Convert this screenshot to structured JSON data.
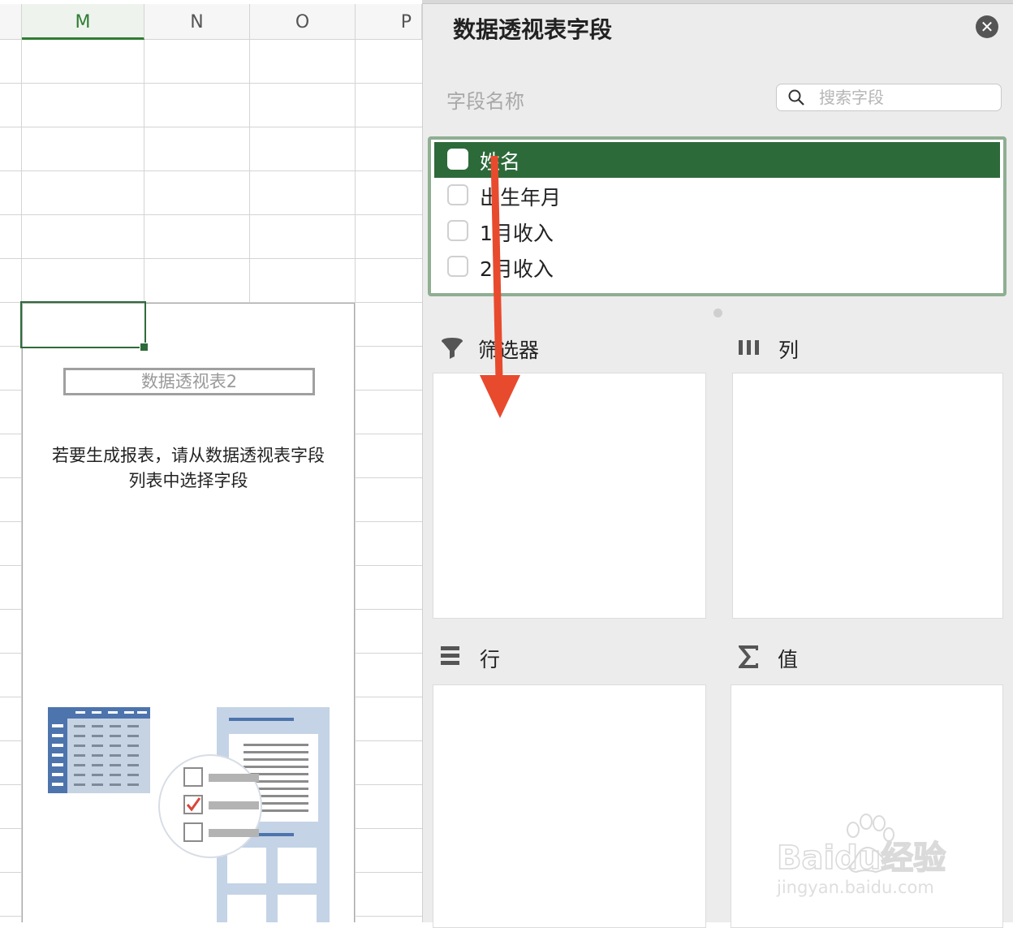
{
  "sheet": {
    "columns": [
      "M",
      "N",
      "O",
      "P"
    ],
    "selected_column": "M",
    "pivot": {
      "name": "数据透视表2",
      "hint_line1": "若要生成报表，请从数据透视表字段",
      "hint_line2": "列表中选择字段"
    }
  },
  "panel": {
    "title": "数据透视表字段",
    "close": "✕",
    "field_name_label": "字段名称",
    "search_placeholder": "搜索字段",
    "fields": [
      {
        "label": "姓名",
        "checked": false,
        "highlighted": true
      },
      {
        "label": "出生年月",
        "checked": false,
        "highlighted": false
      },
      {
        "label": "1月收入",
        "checked": false,
        "highlighted": false
      },
      {
        "label": "2月收入",
        "checked": false,
        "highlighted": false
      }
    ],
    "areas": {
      "filters": "筛选器",
      "columns": "列",
      "rows": "行",
      "values": "值"
    },
    "icons": {
      "filters": "funnel-icon",
      "columns": "column-bars-icon",
      "rows": "row-lines-icon",
      "values": "sigma-icon"
    }
  },
  "watermark": {
    "brand": "Baidu经验",
    "url": "jingyan.baidu.com"
  },
  "colors": {
    "accent": "#2d6a3a",
    "selected_column": "#2e7d32",
    "arrow": "#e84a2e"
  }
}
